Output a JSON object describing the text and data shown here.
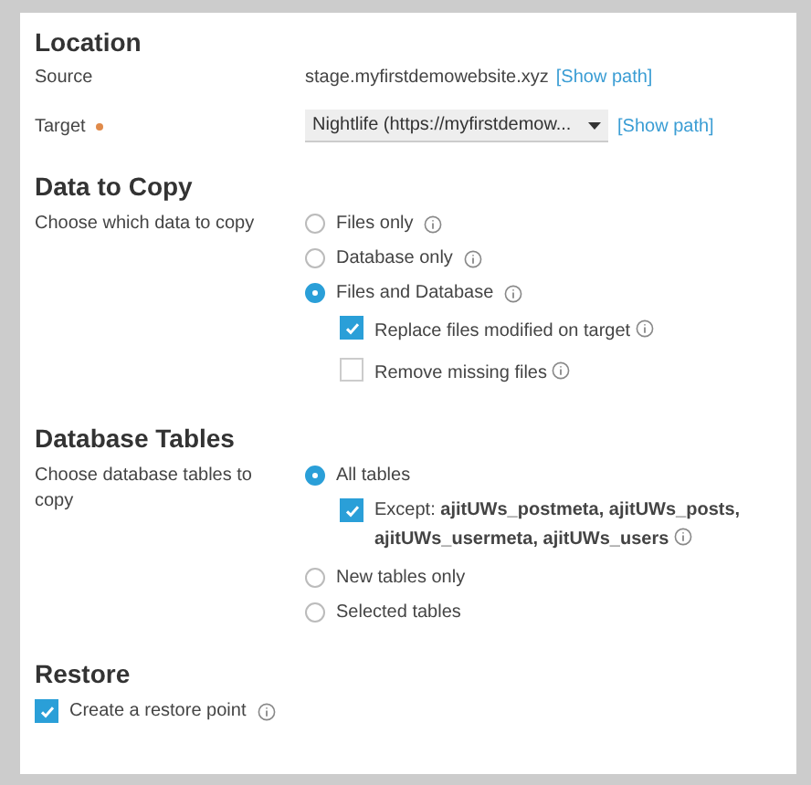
{
  "location": {
    "title": "Location",
    "source": {
      "label": "Source",
      "value": "stage.myfirstdemowebsite.xyz",
      "link": "[Show path]"
    },
    "target": {
      "label": "Target",
      "required": true,
      "value": "Nightlife (https://myfirstdemow...",
      "link": "[Show path]"
    }
  },
  "data_to_copy": {
    "title": "Data to Copy",
    "label": "Choose which data to copy",
    "options": [
      {
        "label": "Files only",
        "selected": false,
        "info": true
      },
      {
        "label": "Database only",
        "selected": false,
        "info": true
      },
      {
        "label": "Files and Database",
        "selected": true,
        "info": true,
        "children": [
          {
            "label": "Replace files modified on target",
            "checked": true,
            "info": true
          },
          {
            "label": "Remove missing files",
            "checked": false,
            "info": true
          }
        ]
      }
    ]
  },
  "database_tables": {
    "title": "Database Tables",
    "label": "Choose database tables to copy",
    "options": [
      {
        "label": "All tables",
        "selected": true,
        "info": false,
        "children": [
          {
            "label": "Except: **ajitUWs_postmeta, ajitUWs_posts, ajitUWs_usermeta, ajitUWs_users**",
            "checked": true,
            "info": true
          }
        ]
      },
      {
        "label": "New tables only",
        "selected": false,
        "info": false
      },
      {
        "label": "Selected tables",
        "selected": false,
        "info": false
      }
    ]
  },
  "restore": {
    "title": "Restore",
    "checkbox": {
      "label": "Create a restore point",
      "checked": true,
      "info": true
    }
  }
}
